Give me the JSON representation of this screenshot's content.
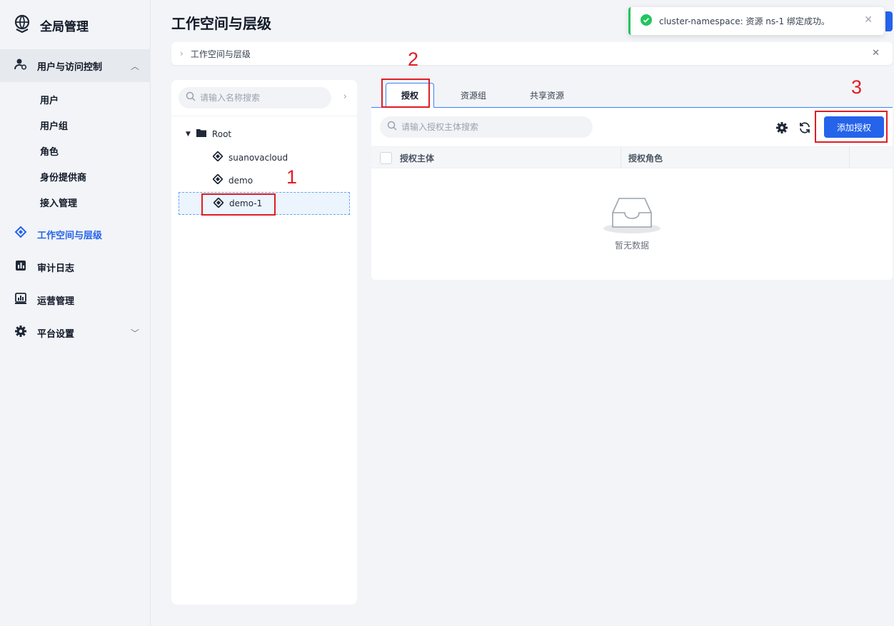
{
  "colors": {
    "accent": "#2563eb",
    "success": "#22c55e",
    "annotation": "#e11d24"
  },
  "sidebar": {
    "brand": "全局管理",
    "groups": [
      {
        "label": "用户与访问控制",
        "icon": "user-gear-icon",
        "expanded": true,
        "items": [
          "用户",
          "用户组",
          "角色",
          "身份提供商",
          "接入管理"
        ]
      },
      {
        "label": "工作空间与层级",
        "icon": "workspace-icon",
        "active": true
      },
      {
        "label": "审计日志",
        "icon": "audit-icon"
      },
      {
        "label": "运营管理",
        "icon": "chart-icon"
      },
      {
        "label": "平台设置",
        "icon": "gear-icon"
      }
    ]
  },
  "header": {
    "title": "工作空间与层级",
    "breadcrumb": "工作空间与层级"
  },
  "toast": {
    "message": "cluster-namespace: 资源 ns-1 绑定成功。"
  },
  "tree": {
    "search_placeholder": "请输入名称搜索",
    "root": "Root",
    "children": [
      "suanovacloud",
      "demo",
      "demo-1"
    ],
    "selected": "demo-1"
  },
  "main": {
    "tabs": [
      "授权",
      "资源组",
      "共享资源"
    ],
    "active_tab": "授权",
    "search_placeholder": "请输入授权主体搜索",
    "add_button": "添加授权",
    "columns": [
      "授权主体",
      "授权角色"
    ],
    "empty_text": "暂无数据"
  },
  "annotations": [
    "1",
    "2",
    "3"
  ]
}
